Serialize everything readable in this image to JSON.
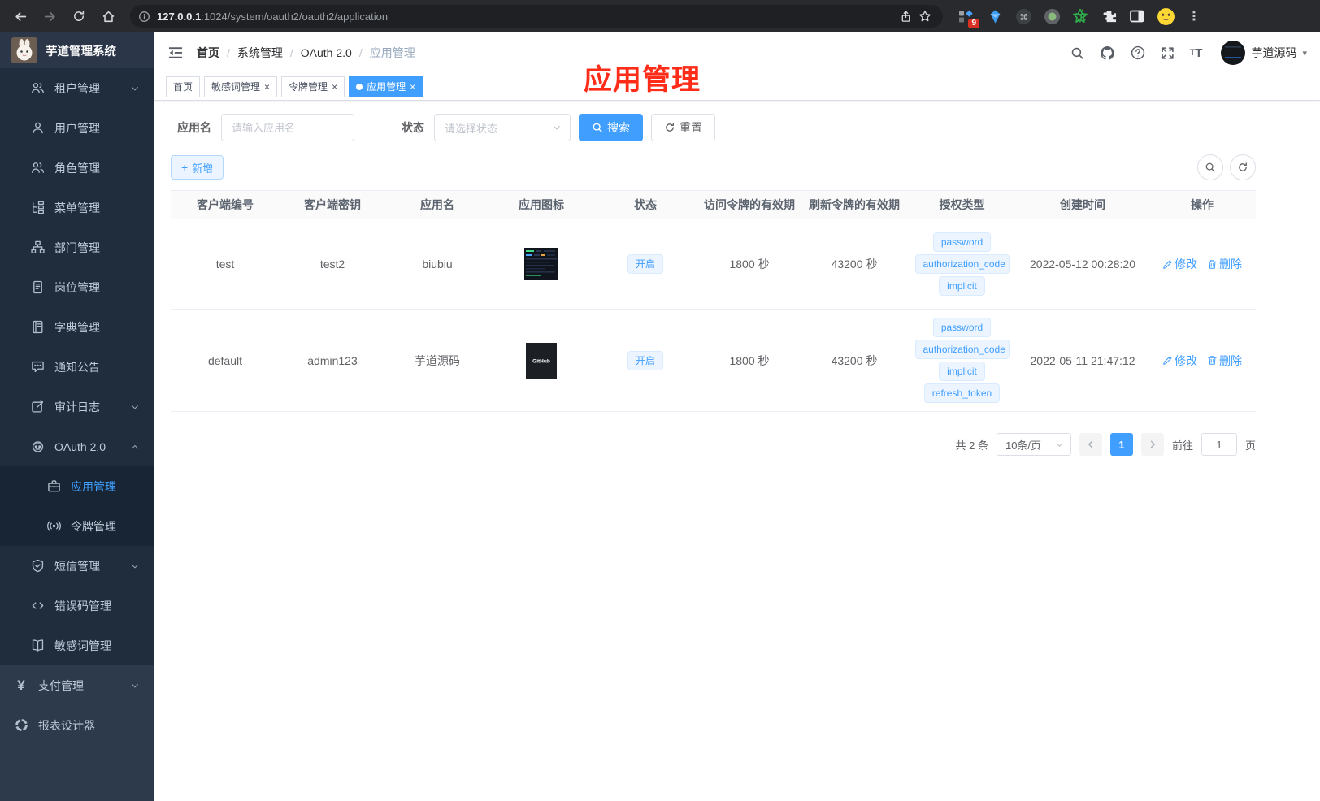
{
  "browser": {
    "url_host": "127.0.0.1",
    "url_path": ":1024/system/oauth2/oauth2/application",
    "extension_badge": "9"
  },
  "sidebar": {
    "logo_title": "芋道管理系统",
    "items": [
      {
        "key": "tenant",
        "icon": "users-icon",
        "label": "租户管理",
        "arrow": "down",
        "level": 2
      },
      {
        "key": "user",
        "icon": "user-icon",
        "label": "用户管理",
        "level": 2
      },
      {
        "key": "role",
        "icon": "role-icon",
        "label": "角色管理",
        "level": 2
      },
      {
        "key": "menu",
        "icon": "menu-tree-icon",
        "label": "菜单管理",
        "level": 2
      },
      {
        "key": "dept",
        "icon": "org-tree-icon",
        "label": "部门管理",
        "level": 2
      },
      {
        "key": "post",
        "icon": "badge-icon",
        "label": "岗位管理",
        "level": 2
      },
      {
        "key": "dict",
        "icon": "dict-book-icon",
        "label": "字典管理",
        "level": 2
      },
      {
        "key": "notice",
        "icon": "message-icon",
        "label": "通知公告",
        "level": 2
      },
      {
        "key": "audit-log",
        "icon": "log-edit-icon",
        "label": "审计日志",
        "arrow": "down",
        "level": 2
      },
      {
        "key": "oauth2",
        "icon": "robot-icon",
        "label": "OAuth 2.0",
        "arrow": "up",
        "level": 2
      },
      {
        "key": "oauth2-application",
        "icon": "briefcase-icon",
        "label": "应用管理",
        "level": 3,
        "active": true
      },
      {
        "key": "oauth2-token",
        "icon": "signal-icon",
        "label": "令牌管理",
        "level": 3
      },
      {
        "key": "sms",
        "icon": "shield-check-icon",
        "label": "短信管理",
        "arrow": "down",
        "level": 2
      },
      {
        "key": "error-code",
        "icon": "code-icon",
        "label": "错误码管理",
        "level": 2
      },
      {
        "key": "sensitive-word",
        "icon": "open-book-icon",
        "label": "敏感词管理",
        "level": 2
      },
      {
        "key": "pay",
        "icon": "yen-icon",
        "label": "支付管理",
        "arrow": "down",
        "level": 1
      },
      {
        "key": "report",
        "icon": "report-wheel-icon",
        "label": "报表设计器",
        "level": 1
      }
    ]
  },
  "navbar": {
    "breadcrumb": [
      "首页",
      "系统管理",
      "OAuth 2.0",
      "应用管理"
    ],
    "username": "芋道源码"
  },
  "tabs": [
    {
      "label": "首页",
      "closable": false,
      "active": false
    },
    {
      "label": "敏感词管理",
      "closable": true,
      "active": false
    },
    {
      "label": "令牌管理",
      "closable": true,
      "active": false
    },
    {
      "label": "应用管理",
      "closable": true,
      "active": true
    }
  ],
  "annotation": {
    "text": "应用管理",
    "color": "#fe2c19"
  },
  "filters": {
    "name_label": "应用名",
    "name_placeholder": "请输入应用名",
    "status_label": "状态",
    "status_placeholder": "请选择状态",
    "search_label": "搜索",
    "reset_label": "重置"
  },
  "toolbar": {
    "add_label": "新增"
  },
  "table": {
    "columns": [
      "客户端编号",
      "客户端密钥",
      "应用名",
      "应用图标",
      "状态",
      "访问令牌的有效期",
      "刷新令牌的有效期",
      "授权类型",
      "创建时间",
      "操作"
    ],
    "rows": [
      {
        "client_id": "test",
        "secret": "test2",
        "name": "biubiu",
        "logo": "screenshot-dark",
        "status": "开启",
        "access_ttl": "1800 秒",
        "refresh_ttl": "43200 秒",
        "grant_types": [
          "password",
          "authorization_code",
          "implicit"
        ],
        "created": "2022-05-12 00:28:20"
      },
      {
        "client_id": "default",
        "secret": "admin123",
        "name": "芋道源码",
        "logo": "github-dark",
        "status": "开启",
        "access_ttl": "1800 秒",
        "refresh_ttl": "43200 秒",
        "grant_types": [
          "password",
          "authorization_code",
          "implicit",
          "refresh_token"
        ],
        "created": "2022-05-11 21:47:12"
      }
    ],
    "actions": {
      "edit": "修改",
      "delete": "删除"
    }
  },
  "pagination": {
    "total_text": "共 2 条",
    "page_size": "10条/页",
    "current_page": "1",
    "goto_label": "前往",
    "goto_value": "1",
    "page_suffix": "页"
  },
  "colors": {
    "accent": "#409eff",
    "sidebar_bg": "#2d3a4b",
    "submenu_bg": "#1f2d3d"
  }
}
